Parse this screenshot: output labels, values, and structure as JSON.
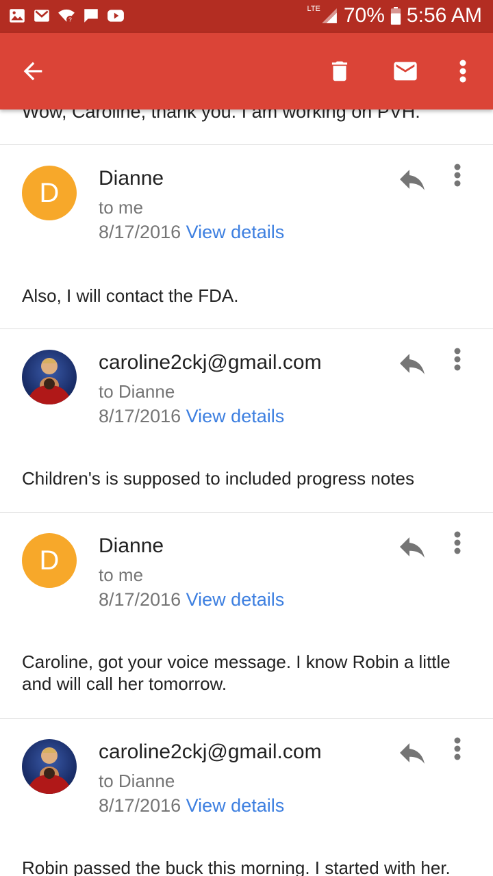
{
  "status_bar": {
    "network": "LTE",
    "battery": "70%",
    "time": "5:56 AM"
  },
  "toolbar": {
    "back_icon": "arrow-back-icon",
    "delete_icon": "trash-icon",
    "mark_unread_icon": "mail-icon",
    "more_icon": "more-vert-icon"
  },
  "thread": {
    "previous_snippet": "Wow, Caroline,  thank you. I am working on PVH.",
    "messages": [
      {
        "avatar_letter": "D",
        "sender": "Dianne",
        "recipient": "to me",
        "date": "8/17/2016",
        "details_link": "View details",
        "body": "Also, I will contact the FDA."
      },
      {
        "avatar_letter": "",
        "sender": "caroline2ckj@gmail.com",
        "recipient": "to Dianne",
        "date": "8/17/2016",
        "details_link": "View details",
        "body": "Children's is supposed to included progress notes"
      },
      {
        "avatar_letter": "D",
        "sender": "Dianne",
        "recipient": "to me",
        "date": "8/17/2016",
        "details_link": "View details",
        "body": "Caroline, got your voice message. I know Robin a little and will call her tomorrow."
      },
      {
        "avatar_letter": "",
        "sender": "caroline2ckj@gmail.com",
        "recipient": "to Dianne",
        "date": "8/17/2016",
        "details_link": "View details",
        "body": "Robin passed the buck this morning. I started with her."
      }
    ]
  },
  "colors": {
    "status_bar": "#b32d22",
    "app_bar": "#db4437",
    "avatar_letter_bg": "#f7a82a",
    "link": "#3d7fe0"
  }
}
